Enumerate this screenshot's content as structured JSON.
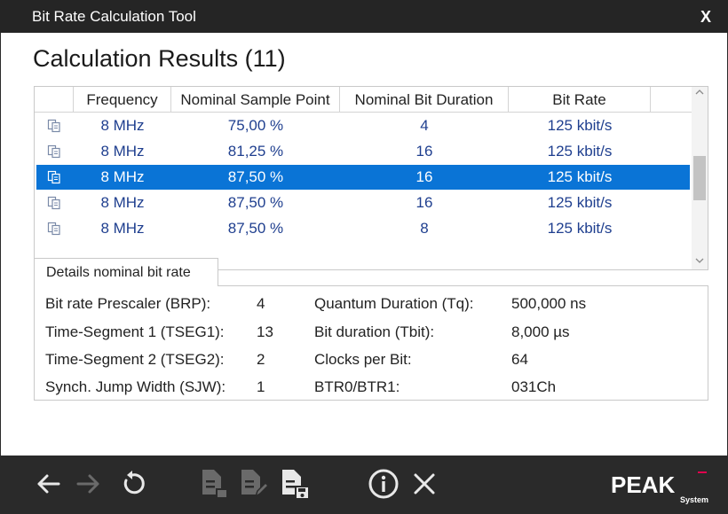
{
  "window": {
    "title": "Bit Rate Calculation Tool",
    "close_label": "X"
  },
  "heading": "Calculation Results (11)",
  "grid": {
    "columns": [
      "Frequency",
      "Nominal Sample Point",
      "Nominal Bit Duration",
      "Bit Rate"
    ],
    "rows": [
      {
        "frequency": "8 MHz",
        "sample_point": "75,00 %",
        "bit_duration": "4",
        "bit_rate": "125 kbit/s",
        "selected": false
      },
      {
        "frequency": "8 MHz",
        "sample_point": "81,25 %",
        "bit_duration": "16",
        "bit_rate": "125 kbit/s",
        "selected": false
      },
      {
        "frequency": "8 MHz",
        "sample_point": "87,50 %",
        "bit_duration": "16",
        "bit_rate": "125 kbit/s",
        "selected": true
      },
      {
        "frequency": "8 MHz",
        "sample_point": "87,50 %",
        "bit_duration": "16",
        "bit_rate": "125 kbit/s",
        "selected": false
      },
      {
        "frequency": "8 MHz",
        "sample_point": "87,50 %",
        "bit_duration": "8",
        "bit_rate": "125 kbit/s",
        "selected": false
      }
    ],
    "row_icon": "copy-document-icon",
    "scroll_up_icon": "chevron-up-icon",
    "scroll_down_icon": "chevron-down-icon"
  },
  "details": {
    "tab_label": "Details nominal bit rate",
    "left": [
      {
        "label": "Bit rate Prescaler (BRP):",
        "value": "4"
      },
      {
        "label": "Time-Segment 1 (TSEG1):",
        "value": "13"
      },
      {
        "label": "Time-Segment 2 (TSEG2):",
        "value": "2"
      },
      {
        "label": "Synch. Jump Width (SJW):",
        "value": "1"
      }
    ],
    "right": [
      {
        "label": "Quantum Duration (Tq):",
        "value": "500,000 ns"
      },
      {
        "label": "Bit duration (Tbit):",
        "value": "8,000 µs"
      },
      {
        "label": "Clocks per Bit:",
        "value": "64"
      },
      {
        "label": "BTR0/BTR1:",
        "value": "031Ch"
      }
    ]
  },
  "toolbar": {
    "icons": [
      "arrow-left-icon",
      "arrow-right-icon",
      "refresh-icon",
      "copy-document-icon",
      "edit-document-icon",
      "save-document-icon",
      "info-icon",
      "close-icon"
    ]
  },
  "brand": {
    "logo_text": "PEAK",
    "logo_sub": "System",
    "accent": "#e0004d"
  },
  "colors": {
    "selection": "#0a74d6",
    "cell_text": "#1f3f8f",
    "titlebar": "#252525"
  }
}
